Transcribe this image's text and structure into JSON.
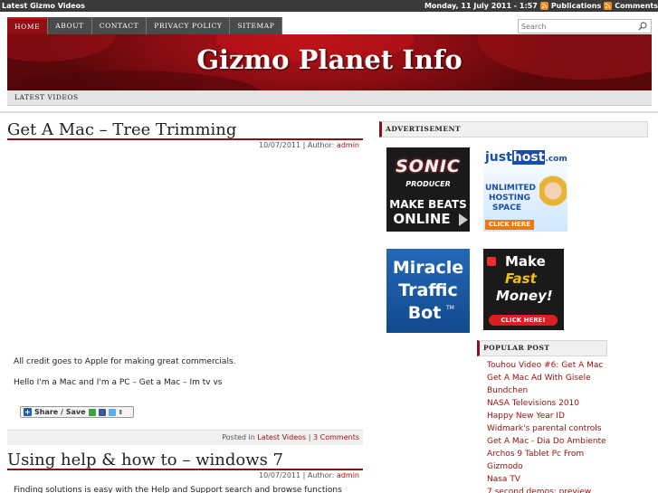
{
  "topbar": {
    "site_name": "Latest Gizmo Videos",
    "date": "Monday, 11 July 2011 - 1:57",
    "publications": "Publications",
    "comments": "Comments"
  },
  "nav": {
    "tabs": [
      "HOME",
      "ABOUT",
      "CONTACT",
      "PRIVACY POLICY",
      "SITEMAP"
    ]
  },
  "search": {
    "placeholder": "Search"
  },
  "header": {
    "title": "Gizmo Planet Info"
  },
  "subnav": {
    "latest_videos": "LATEST VIDEOS"
  },
  "posts": [
    {
      "title": "Get A Mac – Tree Trimming",
      "date": "10/07/2011",
      "author_label": "| Author:",
      "author": "admin",
      "text1": "All credit goes to Apple for making great commercials.",
      "text2": "Hello I'm a Mac and I'm a PC – Get a Mac – Im tv vs",
      "share_label": "Share / Save",
      "posted_in": "Posted in",
      "category": "Latest Videos",
      "comments": "3 Comments"
    },
    {
      "title": "Using help & how to – windows 7",
      "date": "10/07/2011",
      "author_label": "| Author:",
      "author": "admin",
      "text1": "Finding solutions is easy with the Help and Support search and browse functions"
    }
  ],
  "sidebar": {
    "advertisement": "ADVERTISEMENT",
    "ads": {
      "sonic": {
        "line1": "SONIC",
        "line2": "PRODUCER",
        "line3": "MAKE BEATS",
        "line4": "ONLINE"
      },
      "justhost": {
        "brand_a": "just",
        "brand_b": "host",
        "brand_c": ".com",
        "line1": "UNLIMITED",
        "line2": "HOSTING",
        "line3": "SPACE",
        "cta": "CLICK HERE"
      },
      "miracle": {
        "line1": "Miracle",
        "line2": "Traffic",
        "line3": "Bot",
        "tm": "TM"
      },
      "money": {
        "line1": "Make",
        "line2": "Fast",
        "line3": "Money!",
        "cta": "CLICK HERE!"
      }
    },
    "popular_post": "POPULAR POST",
    "popular": [
      "Touhou Video #6: Get A Mac",
      "Get A Mac Ad With Gisele",
      "Bundchen",
      "NASA Televisions 2010",
      "Happy New Year ID",
      "Widmark's parental controls",
      "Get A Mac - Dia Do Ambiente",
      "Archos 9 Tablet Pc From",
      "Gizmodo",
      "Nasa TV",
      "7 second demos: preview"
    ]
  }
}
